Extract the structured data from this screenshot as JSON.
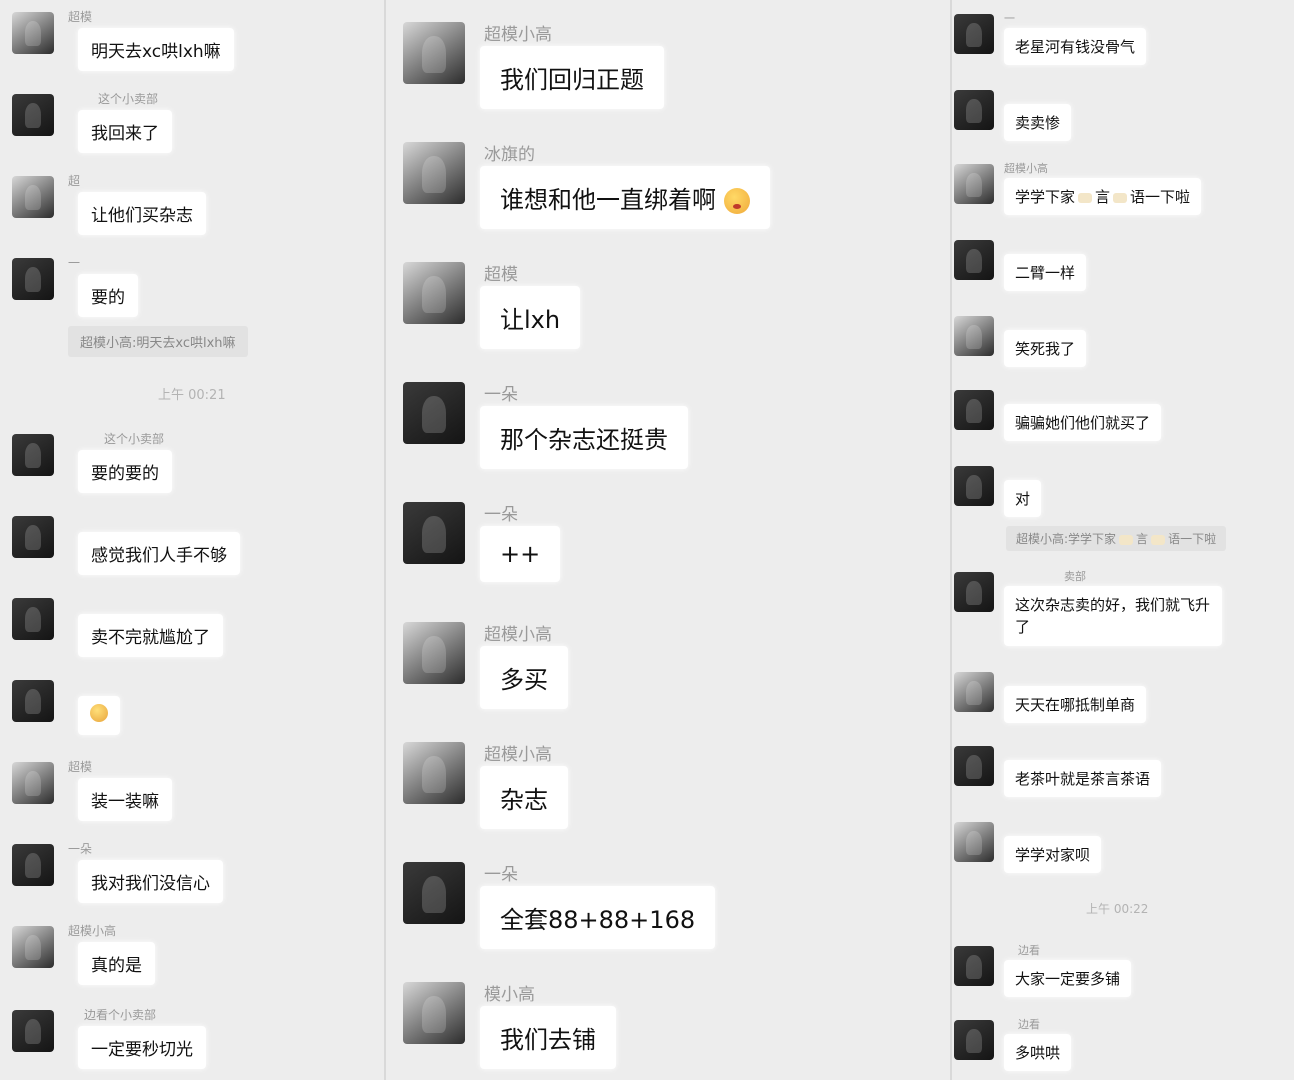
{
  "panel1": {
    "messages": [
      {
        "name": "超模",
        "text": "明天去xc哄lxh嘛"
      },
      {
        "name": "这个小卖部",
        "text": "我回来了"
      },
      {
        "name": "超",
        "text": "让他们买杂志"
      },
      {
        "name": "一",
        "text": "要的"
      },
      {
        "name": "这个小卖部",
        "text": "要的要的"
      },
      {
        "name": "",
        "text": "感觉我们人手不够"
      },
      {
        "name": "",
        "text": "卖不完就尴尬了"
      },
      {
        "name": "",
        "text": ""
      },
      {
        "name": "超模",
        "text": "装一装嘛"
      },
      {
        "name": "一朵",
        "text": "我对我们没信心"
      },
      {
        "name": "超模小高",
        "text": "真的是"
      },
      {
        "name": "边看个小卖部",
        "text": "一定要秒切光"
      }
    ],
    "quote": "超模小高:明天去xc哄lxh嘛",
    "time": "上午 00:21"
  },
  "panel2": {
    "messages": [
      {
        "name": "超模小高",
        "text": "我们回归正题"
      },
      {
        "name": "冰旗的",
        "text": "谁想和他一直绑着啊"
      },
      {
        "name": "超模",
        "text": "让lxh"
      },
      {
        "name": "一朵",
        "text": "那个杂志还挺贵"
      },
      {
        "name": "一朵",
        "text": "++"
      },
      {
        "name": "超模小高",
        "text": "多买"
      },
      {
        "name": "超模小高",
        "text": "杂志"
      },
      {
        "name": "一朵",
        "text": "全套88+88+168"
      },
      {
        "name": "模小高",
        "text": "我们去铺"
      }
    ]
  },
  "panel3": {
    "messages": [
      {
        "name": "一",
        "text": "老星河有钱没骨气"
      },
      {
        "name": "",
        "text": "卖卖惨"
      },
      {
        "name": "超模小高",
        "text_a": "学学下家",
        "text_b": "言",
        "text_c": "语一下啦"
      },
      {
        "name": "",
        "text": "二臂一样"
      },
      {
        "name": "",
        "text": "笑死我了"
      },
      {
        "name": "",
        "text": "骗骗她们他们就买了"
      },
      {
        "name": "",
        "text": "对"
      },
      {
        "name": "卖部",
        "text": "这次杂志卖的好，我们就飞升了"
      },
      {
        "name": "",
        "text": "天天在哪抵制单商"
      },
      {
        "name": "",
        "text": "老茶叶就是茶言茶语"
      },
      {
        "name": "",
        "text": "学学对家呗"
      },
      {
        "name": "边看",
        "text": "大家一定要多铺"
      },
      {
        "name": "边看",
        "text": "多哄哄"
      }
    ],
    "quote_a": "超模小高:学学下家",
    "quote_b": "言",
    "quote_c": "语一下啦",
    "time": "上午 00:22"
  },
  "colors": {
    "background": "#ededed",
    "bubble": "#ffffff",
    "name_text": "#9a9a9a",
    "quote_bg": "#e2e2e2",
    "time_text": "#b3b3b3"
  }
}
